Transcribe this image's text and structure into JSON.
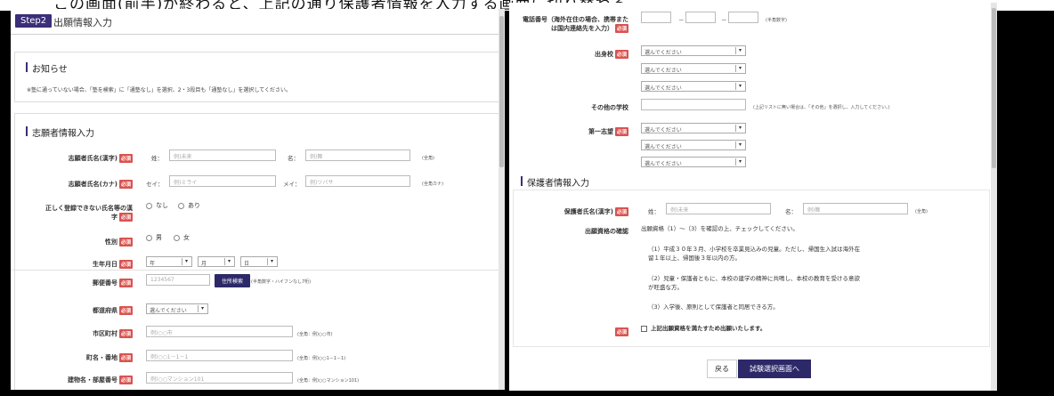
{
  "top_caption": "この画面(前半)が終わると、上記の通り保護者情報を入力する画面に切り替わる。",
  "left": {
    "step_badge": "Step2",
    "step_title": "出願情報入力",
    "notice": {
      "title": "お知らせ",
      "text": "※塾に通っていない場合、「塾を検索」に「通塾なし」を選択、2・3段目も「通塾なし」を選択してください。"
    },
    "applicant": {
      "section_title": "志願者情報入力",
      "required": "必須",
      "name_kanji": {
        "label": "志願者氏名(漢字)",
        "sei": "姓：",
        "mei": "名：",
        "sei_ph": "例)未来",
        "mei_ph": "例)舞",
        "note": "(全角)"
      },
      "name_kana": {
        "label": "志願者氏名(カナ)",
        "sei": "セイ：",
        "mei": "メイ：",
        "sei_ph": "例)ミライ",
        "mei_ph": "例)ツバサ",
        "note": "(全角カナ)"
      },
      "special_chars": {
        "label1": "正しく登録できない氏名等の漢",
        "label2": "字",
        "opt1": "なし",
        "opt2": "あり"
      },
      "gender": {
        "label": "性別",
        "opt1": "男",
        "opt2": "女"
      },
      "birth": {
        "label": "生年月日",
        "year": "年",
        "month": "月",
        "day": "日"
      },
      "postal": {
        "label": "郵便番号",
        "ph": "1234567",
        "button": "住所検索",
        "note": "(半角数字・ハイフンなし7桁)"
      },
      "pref": {
        "label": "都道府県",
        "value": "選んでください"
      },
      "city": {
        "label": "市区町村",
        "ph": "例)○○市",
        "note": "(全角：例)○○市)"
      },
      "town": {
        "label": "町名・番地",
        "ph": "例)○○1－1－1",
        "note": "(全角：例)○○1－1－1)"
      },
      "building": {
        "label": "建物名・部屋番号",
        "ph": "例)○○マンション101",
        "note": "(全角：例)○○マンション101)"
      }
    }
  },
  "right": {
    "required": "必須",
    "phone": {
      "label1": "電話番号（海外在住の場合、携帯また",
      "label2": "は国内連絡先を入力）",
      "dash": "－",
      "note": "(半角数字)"
    },
    "school": {
      "label": "出身校",
      "opts": [
        "選んでください",
        "選んでください",
        "選んでください"
      ]
    },
    "other_school": {
      "label": "その他の学校",
      "note": "(上記リストに無い場合は、「その他」を選択し、入力してください。)"
    },
    "first_choice": {
      "label": "第一志望",
      "opts": [
        "選んでください",
        "選んでください",
        "選んでください"
      ]
    },
    "guardian": {
      "section_title": "保護者情報入力",
      "name": {
        "label": "保護者氏名(漢字)",
        "sei": "姓：",
        "mei": "名：",
        "sei_ph": "例)未来",
        "mei_ph": "例)舞",
        "note": "(全角)"
      },
      "qual_label": "出願資格の確認",
      "qual_intro": "出願資格（1）～（3）を確認の上、チェックしてください。",
      "q1a": "（1）平成３０年３月、小学校を卒業見込みの児童。ただし、帰国生入試は海外在",
      "q1b": "留１年以上、帰国後３年以内の方。",
      "q2a": "（2）児童・保護者ともに、本校の建学の精神に共鳴し、本校の教育を受ける意欲",
      "q2b": "が旺盛な方。",
      "q3": "（3）入学後、原則として保護者と同居できる方。",
      "confirm": "上記出願資格を満たすため出願いたします。"
    },
    "back_button": "戻る",
    "next_button": "試験選択画面へ"
  }
}
